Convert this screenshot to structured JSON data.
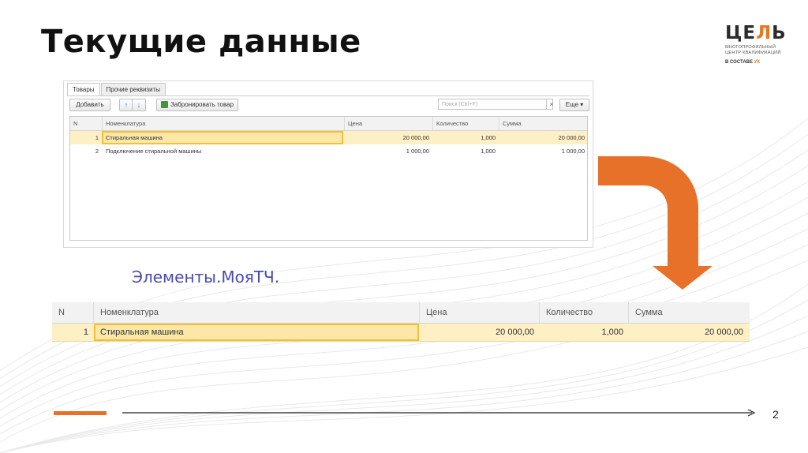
{
  "slide": {
    "title": "Текущие данные",
    "page_number": "2",
    "accent_color": "#e8712a"
  },
  "logo": {
    "main_left": "ЦЕ",
    "main_accent": "Л",
    "main_right": "Ь",
    "subtitle_line1": "МНОГОПРОФИЛЬНЫЙ",
    "subtitle_line2": "ЦЕНТР КВАЛИФИКАЦИЙ",
    "footer_prefix": "В СОСТАВЕ",
    "footer_brand": "УК"
  },
  "form": {
    "tabs": [
      "Товары",
      "Прочие реквизиты"
    ],
    "active_tab": "Товары",
    "toolbar": {
      "add_label": "Добавить",
      "up_icon": "arrow-up-icon",
      "down_icon": "arrow-down-icon",
      "reserve_label": "Забронировать товар",
      "search_placeholder": "Поиск (Ctrl+F)",
      "clear_glyph": "×",
      "more_label": "Еще",
      "more_glyph": "▾"
    },
    "columns": [
      "N",
      "Номенклатура",
      "Цена",
      "Количество",
      "Сумма"
    ],
    "rows": [
      {
        "n": "1",
        "item": "Стиральная машина",
        "price": "20 000,00",
        "qty": "1,000",
        "sum": "20 000,00"
      },
      {
        "n": "2",
        "item": "Подключение стиральной машины",
        "price": "1 000,00",
        "qty": "1,000",
        "sum": "1 000,00"
      }
    ]
  },
  "current_data": {
    "label": "Элементы.МояТЧ.",
    "columns": [
      "N",
      "Номенклатура",
      "Цена",
      "Количество",
      "Сумма"
    ],
    "row": {
      "n": "1",
      "item": "Стиральная машина",
      "price": "20 000,00",
      "qty": "1,000",
      "sum": "20 000,00"
    }
  },
  "colors": {
    "selected_row": "#fdf0c5",
    "selected_cell_border": "#f2c037",
    "arrow": "#e8712a",
    "label_text": "#4a4ab0"
  }
}
